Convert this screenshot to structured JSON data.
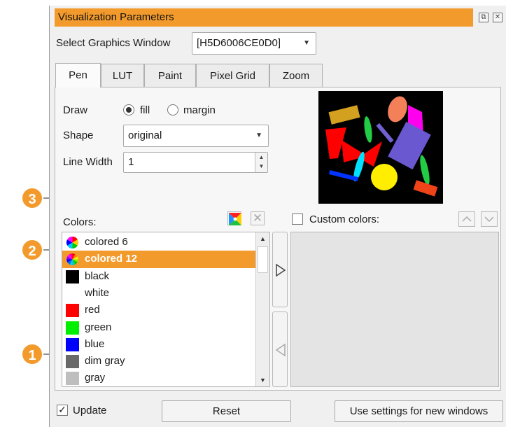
{
  "window": {
    "title": "Visualization Parameters",
    "restore_icon": "restore-icon",
    "close_icon": "close-icon"
  },
  "graphics_window": {
    "label": "Select Graphics Window",
    "value": "[H5D6006CE0D0]"
  },
  "tabs": [
    {
      "label": "Pen",
      "active": true
    },
    {
      "label": "LUT",
      "active": false
    },
    {
      "label": "Paint",
      "active": false
    },
    {
      "label": "Pixel Grid",
      "active": false
    },
    {
      "label": "Zoom",
      "active": false
    }
  ],
  "pen": {
    "draw_label": "Draw",
    "draw_options": [
      "fill",
      "margin"
    ],
    "draw_selected": "fill",
    "shape_label": "Shape",
    "shape_value": "original",
    "line_width_label": "Line Width",
    "line_width_value": "1"
  },
  "colors": {
    "label": "Colors:",
    "items": [
      {
        "label": "colored 6",
        "swatch": "rainbow-6"
      },
      {
        "label": "colored 12",
        "swatch": "rainbow-12",
        "selected": true
      },
      {
        "label": "black",
        "swatch": "#000000"
      },
      {
        "label": "white",
        "swatch": "#ffffff"
      },
      {
        "label": "red",
        "swatch": "#ff0000"
      },
      {
        "label": "green",
        "swatch": "#00ee00"
      },
      {
        "label": "blue",
        "swatch": "#0000ff"
      },
      {
        "label": "dim gray",
        "swatch": "#696969"
      },
      {
        "label": "gray",
        "swatch": "#bebebe"
      }
    ]
  },
  "custom_colors": {
    "label": "Custom colors:",
    "checked": false
  },
  "footer": {
    "update_label": "Update",
    "update_checked": true,
    "reset_label": "Reset",
    "use_settings_label": "Use settings for new windows"
  },
  "callouts": [
    "1",
    "2",
    "3"
  ],
  "accent_color": "#f39a2c"
}
